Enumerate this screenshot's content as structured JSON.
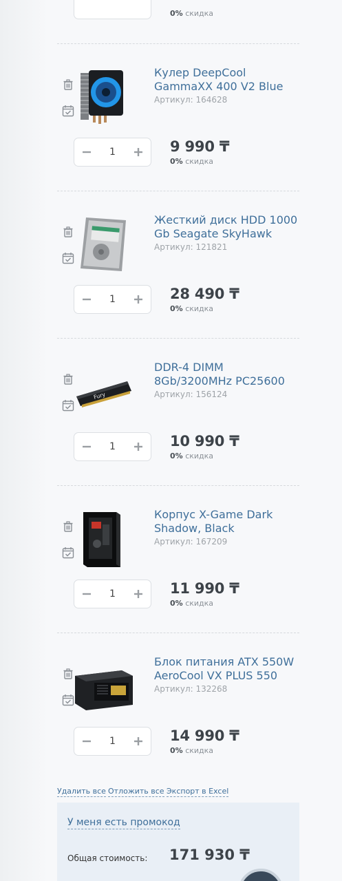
{
  "prev_item": {
    "discount_value": "0%",
    "discount_text": "скидка"
  },
  "items": [
    {
      "title": "Кулер DeepCool GammaXX 400 V2 Blue",
      "sku": "Артикул: 164628",
      "qty": "1",
      "price": "9 990 ₸",
      "discount_value": "0%",
      "discount_text": "скидка",
      "image": "cpu-cooler-image"
    },
    {
      "title": "Жесткий диск HDD 1000 Gb Seagate SkyHawk",
      "sku": "Артикул: 121821",
      "qty": "1",
      "price": "28 490 ₸",
      "discount_value": "0%",
      "discount_text": "скидка",
      "image": "hard-drive-image"
    },
    {
      "title": "DDR-4 DIMM 8Gb/3200MHz PC25600",
      "sku": "Артикул: 156124",
      "qty": "1",
      "price": "10 990 ₸",
      "discount_value": "0%",
      "discount_text": "скидка",
      "image": "ram-module-image"
    },
    {
      "title": "Корпус X-Game Dark Shadow, Black",
      "sku": "Артикул: 167209",
      "qty": "1",
      "price": "11 990 ₸",
      "discount_value": "0%",
      "discount_text": "скидка",
      "image": "pc-case-image"
    },
    {
      "title": "Блок питания ATX 550W AeroCool VX PLUS 550",
      "sku": "Артикул: 132268",
      "qty": "1",
      "price": "14 990 ₸",
      "discount_value": "0%",
      "discount_text": "скидка",
      "image": "power-supply-image"
    }
  ],
  "actions": {
    "delete_all": "Удалить все",
    "defer_all": "Отложить все",
    "export_excel": "Экспорт в Excel"
  },
  "summary": {
    "promo_link": "У меня есть промокод",
    "total_label": "Общая стоимость:",
    "total_value": "171 930 ₸"
  },
  "icons": {
    "delete": "trash-icon",
    "defer": "calendar-check-icon",
    "decrease": "minus-icon",
    "increase": "plus-icon"
  },
  "colors": {
    "link": "#3f6f9a",
    "price": "#3d4349",
    "summary_bg": "#e9eff6",
    "fab": "#39495a"
  }
}
